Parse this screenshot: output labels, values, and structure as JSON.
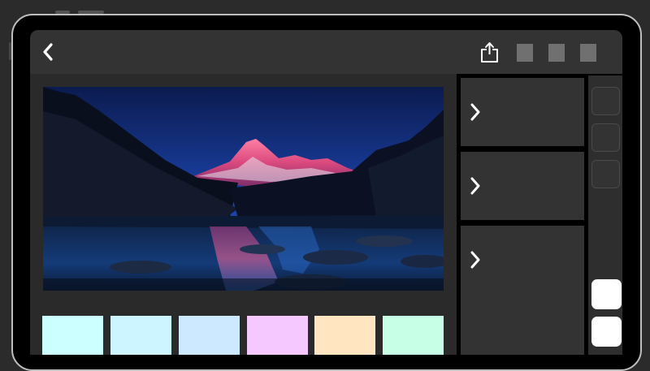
{
  "device": {
    "bezel_color": "#bfbfbf",
    "screen_color": "#000000"
  },
  "toolbar": {
    "back_icon": "chevron-left-icon",
    "share_icon": "share-icon",
    "placeholder_buttons": 3,
    "background": "#333333"
  },
  "photo": {
    "subject": "mountain-lake-at-dusk"
  },
  "swatches": [
    "#ccffff",
    "#ccf5ff",
    "#cce9ff",
    "#f5c9ff",
    "#ffe6c0",
    "#c7ffe6"
  ],
  "panels": [
    {
      "icon": "chevron-right-icon"
    },
    {
      "icon": "chevron-right-icon"
    },
    {
      "icon": "chevron-right-icon"
    }
  ],
  "sidebar": {
    "outline_buttons": 3,
    "white_buttons": 2
  }
}
